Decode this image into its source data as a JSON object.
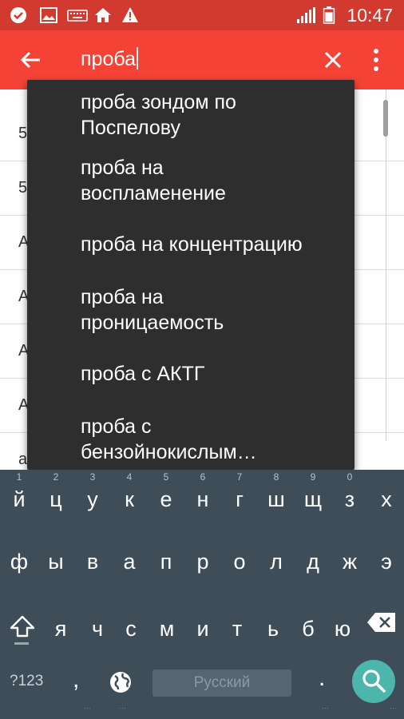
{
  "status_bar": {
    "time": "10:47",
    "icons": [
      "check-icon",
      "image-icon",
      "keyboard-icon",
      "home-icon",
      "warning-icon",
      "signal-icon",
      "battery-icon"
    ]
  },
  "search": {
    "query": "проба"
  },
  "background_list": [
    "5",
    "5",
    "А",
    "А",
    "А",
    "А",
    "а"
  ],
  "suggestions": [
    {
      "line1": "проба зондом по",
      "line2": "Поспелову"
    },
    {
      "line1": "проба на",
      "line2": "воспламенение"
    },
    {
      "line1": "проба на концентрацию",
      "line2": ""
    },
    {
      "line1": "проба на",
      "line2": "проницаемость"
    },
    {
      "line1": "проба с АКТГ",
      "line2": ""
    },
    {
      "line1": "проба с",
      "line2": "бензойнокислым…"
    }
  ],
  "keyboard": {
    "row1": [
      {
        "ch": "й",
        "num": "1"
      },
      {
        "ch": "ц",
        "num": "2"
      },
      {
        "ch": "у",
        "num": "3"
      },
      {
        "ch": "к",
        "num": "4"
      },
      {
        "ch": "е",
        "num": "5"
      },
      {
        "ch": "н",
        "num": "6"
      },
      {
        "ch": "г",
        "num": "7"
      },
      {
        "ch": "ш",
        "num": "8"
      },
      {
        "ch": "щ",
        "num": "9"
      },
      {
        "ch": "з",
        "num": "0"
      },
      {
        "ch": "х",
        "num": ""
      }
    ],
    "row2": [
      "ф",
      "ы",
      "в",
      "а",
      "п",
      "р",
      "о",
      "л",
      "д",
      "ж",
      "э"
    ],
    "row3": [
      "я",
      "ч",
      "с",
      "м",
      "и",
      "т",
      "ь",
      "б",
      "ю"
    ],
    "sym_label": "?123",
    "comma": ",",
    "space_label": "Русский",
    "period": "."
  },
  "colors": {
    "app_bar": "#f44336",
    "status_bar": "#d33a2f",
    "dropdown_bg": "#2e2e2e",
    "keyboard_bg": "#3e4d58",
    "search_key": "#4db6ac"
  }
}
